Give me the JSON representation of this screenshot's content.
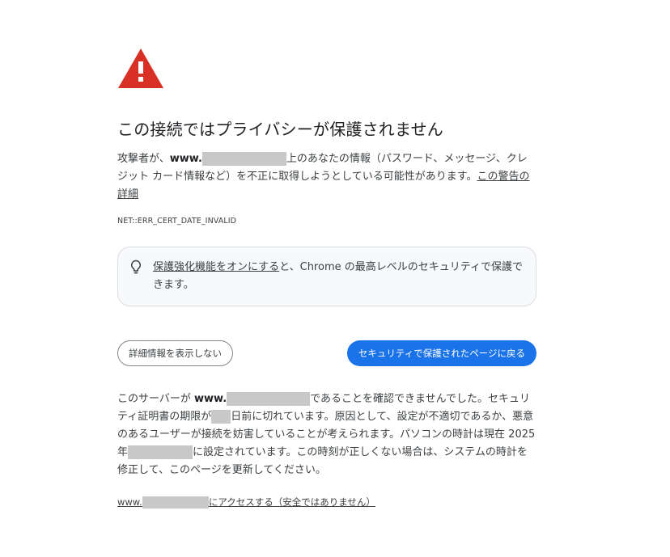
{
  "icons": {
    "warning": "warning-triangle-icon",
    "bulb": "lightbulb-icon"
  },
  "colors": {
    "warning_red": "#d93025",
    "primary_blue": "#1a73e8"
  },
  "title": "この接続ではプライバシーが保護されません",
  "description": {
    "prefix": "攻撃者が、",
    "host_prefix": "www.",
    "suffix": "上のあなたの情報（パスワード、メッセージ、クレジット カード情報など）を不正に取得しようとしている可能性があります。",
    "learn_more_link": "この警告の詳細"
  },
  "error_code": "NET::ERR_CERT_DATE_INVALID",
  "enhanced_protection": {
    "link": "保護強化機能をオンにする",
    "text": "と、Chrome の最高レベルのセキュリティで保護できます。"
  },
  "buttons": {
    "details": "詳細情報を表示しない",
    "back": "セキュリティで保護されたページに戻る"
  },
  "details": {
    "part1": "このサーバーが ",
    "host_prefix": "www.",
    "part2": "であることを確認できませんでした。セキュリティ証明書の期限が",
    "part3": "日前に切れています。原因として、設定が不適切であるか、悪意のあるユーザーが接続を妨害していることが考えられます。パソコンの時計は現在 2025 年",
    "part4": "に設定されています。この時刻が正しくない場合は、システムの時計を修正して、このページを更新してください。"
  },
  "proceed": {
    "host_prefix": "www.",
    "text": "にアクセスする（安全ではありません）"
  }
}
